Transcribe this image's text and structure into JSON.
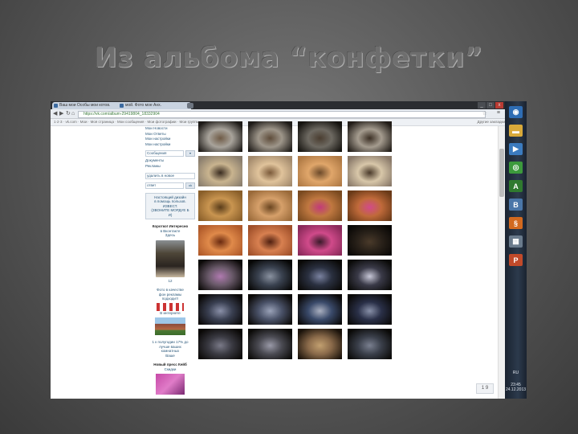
{
  "slide": {
    "title": "Из альбома “конфетки”"
  },
  "browser": {
    "tabs": [
      {
        "label": "Ваш мои Особы мои котов."
      },
      {
        "label": "мой. Фото мое Анх."
      }
    ],
    "url": "https://vk.com/album-29419804_18332904",
    "nav": {
      "back": "◀",
      "forward": "▶",
      "reload": "↻",
      "home": "⌂"
    },
    "window_buttons": {
      "minimize": "_",
      "maximize": "□",
      "close": "x"
    },
    "bookmarks_text": "1·2·3 · vk.com · Мои · Моя страница · Мои сообщения · Мои фотографии · Мои группы",
    "bookmarks_right": "Другие закладки"
  },
  "sidebar": {
    "links": [
      "Мои Новости",
      "Мои Ответы",
      "Мои настройки",
      "Мои настройки"
    ],
    "selects": [
      {
        "value": "Сообщения",
        "button": "▾"
      },
      {
        "value": "Документы",
        "button": ""
      },
      {
        "value": "Рекламы",
        "button": ""
      },
      {
        "value": "удалить в новое",
        "button": ""
      },
      {
        "value": "ответ",
        "button": "ok"
      }
    ],
    "notice_lines": [
      "Настоящий дизайн",
      "в помощь пользов.",
      "ИЗВЕСТ.",
      "(ЗВОНИТЕ МОРДУЕ Б",
      "И)"
    ],
    "ad1": {
      "title": "Коротко! Интересно",
      "subtitle": "в Вконтакте",
      "caption": "Здесь"
    },
    "ad2": {
      "lines": [
        "Фото в качестве",
        "фон рекламы",
        "подходит!"
      ],
      "caption": "В интернете"
    },
    "ad3": {
      "lines": [
        "1 к полугодии 17% до",
        "лучше ваших",
        "комнатных"
      ],
      "caption": "Ваше"
    },
    "ad4": {
      "title": "Новый пресс Кейб",
      "subtitle": "Скидки"
    },
    "small_mark": "12"
  },
  "pagination": {
    "label": "1 9"
  },
  "taskbar": {
    "items": [
      {
        "icon": "start-orb-icon",
        "color": "#2e6db4",
        "glyph": "◉"
      },
      {
        "icon": "folder-icon",
        "color": "#d8a93a",
        "glyph": "▬"
      },
      {
        "icon": "media-player-icon",
        "color": "#3b7bbf",
        "glyph": "▶"
      },
      {
        "icon": "chrome-icon",
        "color": "#3c9a3c",
        "glyph": "◎"
      },
      {
        "icon": "acrobat-icon",
        "color": "#2f7a2f",
        "glyph": "A"
      },
      {
        "icon": "vk-icon",
        "color": "#4a76a8",
        "glyph": "B"
      },
      {
        "icon": "app-icon",
        "color": "#d2691e",
        "glyph": "§"
      },
      {
        "icon": "calculator-icon",
        "color": "#6a7b8c",
        "glyph": "▦"
      },
      {
        "icon": "powerpoint-icon",
        "color": "#c14a2a",
        "glyph": "P"
      }
    ],
    "tray": "RU",
    "time": "23:45",
    "date": "24.12.2013"
  },
  "photos": [
    {
      "colors": [
        "#1d1a17",
        "#a8a39b",
        "#6f5b46"
      ]
    },
    {
      "colors": [
        "#1e1b18",
        "#9e968a",
        "#5e4c3a"
      ]
    },
    {
      "colors": [
        "#15130f",
        "#6e6a62",
        "#4a3d30"
      ]
    },
    {
      "colors": [
        "#221d18",
        "#a59c8f",
        "#3b2f24"
      ]
    },
    {
      "colors": [
        "#8a7e6e",
        "#c9b48f",
        "#3a2c20"
      ]
    },
    {
      "colors": [
        "#a38a6d",
        "#e0c39b",
        "#7b5a3a"
      ]
    },
    {
      "colors": [
        "#b07a45",
        "#e0a66a",
        "#6c4a2a"
      ]
    },
    {
      "colors": [
        "#8a7a6a",
        "#d8c7a9",
        "#4a3a2a"
      ]
    },
    {
      "colors": [
        "#8a5f2a",
        "#c99550",
        "#5a3d1a"
      ]
    },
    {
      "colors": [
        "#9a6a3a",
        "#d6a06a",
        "#6a4520"
      ]
    },
    {
      "colors": [
        "#7a4a20",
        "#c07840",
        "#c23a7a"
      ]
    },
    {
      "colors": [
        "#6a3a18",
        "#c06a3a",
        "#d24a8a"
      ]
    },
    {
      "colors": [
        "#b05a2a",
        "#e08a4a",
        "#6a2a10"
      ]
    },
    {
      "colors": [
        "#a0502a",
        "#d88050",
        "#502010"
      ]
    },
    {
      "colors": [
        "#8a2a5a",
        "#d04a8a",
        "#3a1a2a"
      ]
    },
    {
      "colors": [
        "#0a0806",
        "#2a221a",
        "#4a3a2a"
      ]
    },
    {
      "colors": [
        "#0c0a08",
        "#6a5a6a",
        "#b07ab0"
      ]
    },
    {
      "colors": [
        "#070706",
        "#3a4250",
        "#8a92a0"
      ]
    },
    {
      "colors": [
        "#0a0907",
        "#2a3040",
        "#7a82a0"
      ]
    },
    {
      "colors": [
        "#0a0a08",
        "#3a3a48",
        "#c8c8d8"
      ]
    },
    {
      "colors": [
        "#0a0807",
        "#3a4052",
        "#8a90a8"
      ]
    },
    {
      "colors": [
        "#0b0907",
        "#4a5268",
        "#9aa2b8"
      ]
    },
    {
      "colors": [
        "#0a0807",
        "#3a4a6a",
        "#aab0c0"
      ]
    },
    {
      "colors": [
        "#0a0908",
        "#2a3048",
        "#8890a8"
      ]
    },
    {
      "colors": [
        "#0a0806",
        "#3a3a42",
        "#7a7a88"
      ]
    },
    {
      "colors": [
        "#0b0a08",
        "#4a4a52",
        "#9a9aa8"
      ]
    },
    {
      "colors": [
        "#1a120a",
        "#8a6a4a",
        "#c2a070"
      ]
    },
    {
      "colors": [
        "#0a0907",
        "#3a3f4a",
        "#7a8090"
      ]
    }
  ]
}
